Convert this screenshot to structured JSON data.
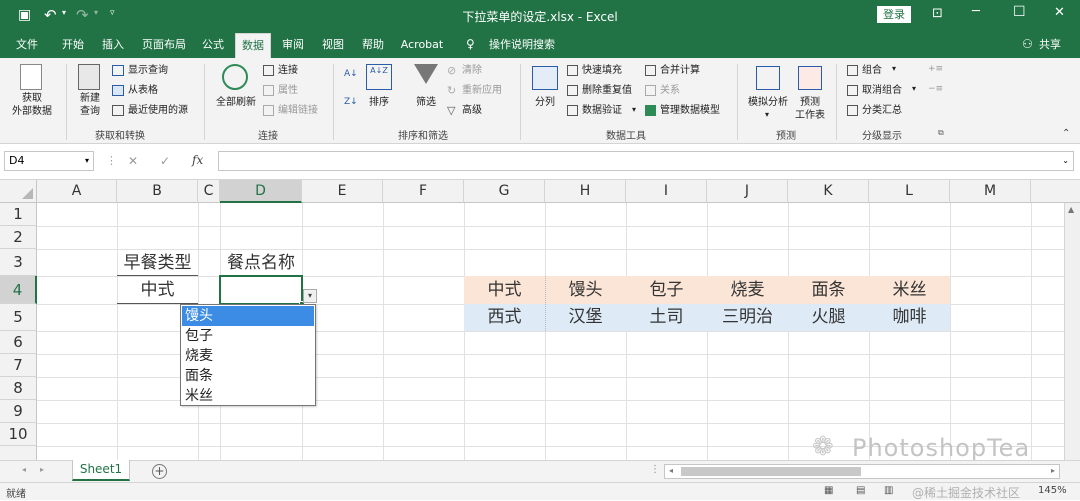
{
  "titlebar": {
    "doc_title": "下拉菜单的设定.xlsx - Excel",
    "login_label": "登录",
    "minimize": "─",
    "maximize": "☐",
    "close": "✕"
  },
  "tabs": {
    "items": [
      "文件",
      "开始",
      "插入",
      "页面布局",
      "公式",
      "数据",
      "审阅",
      "视图",
      "帮助",
      "Acrobat",
      "操作说明搜索"
    ],
    "active": "数据",
    "share": "共享"
  },
  "ribbon": {
    "get_data": {
      "line1": "获取",
      "line2": "外部数据"
    },
    "new_query": {
      "line1": "新建",
      "line2": "查询"
    },
    "show_query": "显示查询",
    "from_table": "从表格",
    "recent_sources": "最近使用的源",
    "group_get_transform": "获取和转换",
    "refresh_all": "全部刷新",
    "connections": "连接",
    "properties": "属性",
    "edit_links": "编辑链接",
    "group_connections": "连接",
    "sort_az": "A↓Z",
    "sort": "排序",
    "filter": "筛选",
    "clear": "清除",
    "reapply": "重新应用",
    "advanced": "高级",
    "group_sort_filter": "排序和筛选",
    "text_to_columns": "分列",
    "flash_fill": "快速填充",
    "remove_duplicates": "删除重复值",
    "data_validation": "数据验证",
    "consolidate": "合并计算",
    "relationships": "关系",
    "manage_data_model": "管理数据模型",
    "group_data_tools": "数据工具",
    "what_if": "模拟分析",
    "forecast": {
      "line1": "预测",
      "line2": "工作表"
    },
    "group_forecast": "预测",
    "group_btn": "组合",
    "ungroup_btn": "取消组合",
    "subtotal": "分类汇总",
    "group_outline": "分级显示"
  },
  "formula_bar": {
    "name_box": "D4",
    "fx": "fx",
    "cancel": "✕",
    "enter": "✓",
    "formula": ""
  },
  "columns": [
    "A",
    "B",
    "C",
    "D",
    "E",
    "F",
    "G",
    "H",
    "I",
    "J",
    "K",
    "L",
    "M"
  ],
  "rows": [
    "1",
    "2",
    "3",
    "4",
    "5",
    "6",
    "7",
    "8",
    "9",
    "10"
  ],
  "cells": {
    "B3": "早餐类型",
    "D3": "餐点名称",
    "B4": "中式",
    "G4": "中式",
    "H4": "馒头",
    "I4": "包子",
    "J4": "烧麦",
    "K4": "面条",
    "L4": "米丝",
    "G5": "西式",
    "H5": "汉堡",
    "I5": "土司",
    "J5": "三明治",
    "K5": "火腿",
    "L5": "咖啡"
  },
  "dropdown": {
    "options": [
      "馒头",
      "包子",
      "烧麦",
      "面条",
      "米丝"
    ],
    "selected": "馒头"
  },
  "colors": {
    "excel_green": "#217346",
    "row4_fill": "#fbe5d6",
    "row5_fill": "#deebf7",
    "dropdown_highlight": "#3c8ce6"
  },
  "sheet": {
    "tab": "Sheet1",
    "add": "+"
  },
  "status": {
    "ready": "就绪",
    "zoom": "145%"
  },
  "watermark": {
    "brand": "PhotoshopTea",
    "community": "@稀土掘金技术社区"
  }
}
